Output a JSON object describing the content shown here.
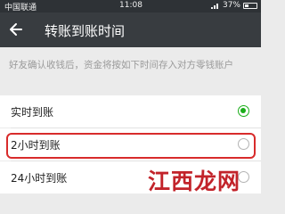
{
  "status_bar": {
    "carrier": "中国联通",
    "time": "11:08",
    "battery": "37%",
    "battery_level": 0.37
  },
  "header": {
    "back_icon": "back-arrow-icon",
    "title": "转账到账时间"
  },
  "description": "好友确认收钱后，资金将按如下时间存入对方零钱账户",
  "options": [
    {
      "label": "实时到账",
      "selected": true
    },
    {
      "label": "2小时到账",
      "selected": false
    },
    {
      "label": "24小时到账",
      "selected": false
    }
  ],
  "watermark": "江西龙网",
  "colors": {
    "accent_green": "#1aad19",
    "highlight_red": "#d82b2b",
    "header_bg": "#383c40"
  }
}
